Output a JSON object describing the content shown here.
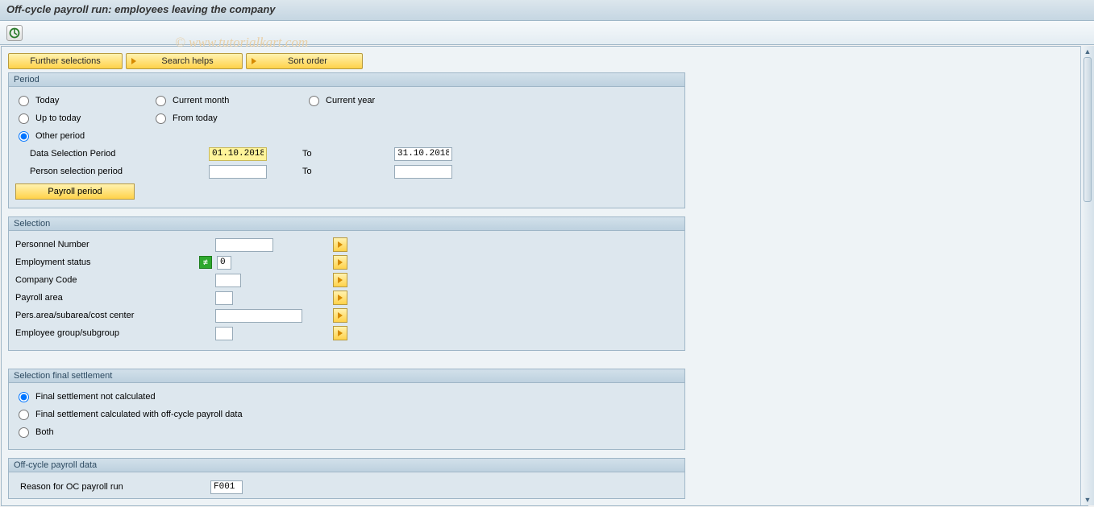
{
  "title": "Off-cycle payroll run: employees leaving the company",
  "watermark": "© www.tutorialkart.com",
  "toolbar_buttons": {
    "further_selections": "Further selections",
    "search_helps": "Search helps",
    "sort_order": "Sort order"
  },
  "period": {
    "group_title": "Period",
    "today": "Today",
    "current_month": "Current month",
    "current_year": "Current year",
    "up_to_today": "Up to today",
    "from_today": "From today",
    "other_period": "Other period",
    "data_selection_period_label": "Data Selection Period",
    "data_from": "01.10.2018",
    "data_to": "31.10.2018",
    "person_selection_period_label": "Person selection period",
    "person_from": "",
    "person_to": "",
    "to_label": "To",
    "payroll_period_btn": "Payroll period"
  },
  "selection": {
    "group_title": "Selection",
    "personnel_number": "Personnel Number",
    "employment_status": "Employment status",
    "employment_status_value": "0",
    "company_code": "Company Code",
    "payroll_area": "Payroll area",
    "pers_area": "Pers.area/subarea/cost center",
    "employee_group": "Employee group/subgroup"
  },
  "final_settlement": {
    "group_title": "Selection final settlement",
    "not_calculated": "Final settlement not calculated",
    "calculated_with_oc": "Final settlement calculated with off-cycle payroll data",
    "both": "Both"
  },
  "oc_payroll": {
    "group_title": "Off-cycle payroll data",
    "reason_label": "Reason for OC payroll run",
    "reason_value": "F001"
  }
}
